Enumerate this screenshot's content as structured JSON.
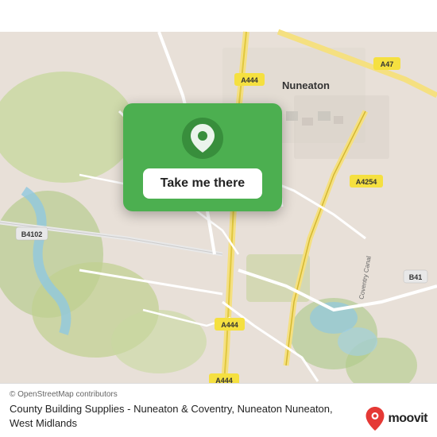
{
  "map": {
    "attribution": "© OpenStreetMap contributors",
    "road_labels": [
      "A444",
      "A444",
      "A444",
      "A4254",
      "A47",
      "B4102",
      "B41",
      "Nuneaton"
    ],
    "accent_color": "#4caf50"
  },
  "card": {
    "button_label": "Take me there",
    "pin_icon": "location-pin"
  },
  "info": {
    "location_name": "County Building Supplies - Nuneaton & Coventry, Nuneaton Nuneaton, West Midlands"
  },
  "moovit": {
    "brand_name": "moovit",
    "pin_color": "#e53935"
  }
}
